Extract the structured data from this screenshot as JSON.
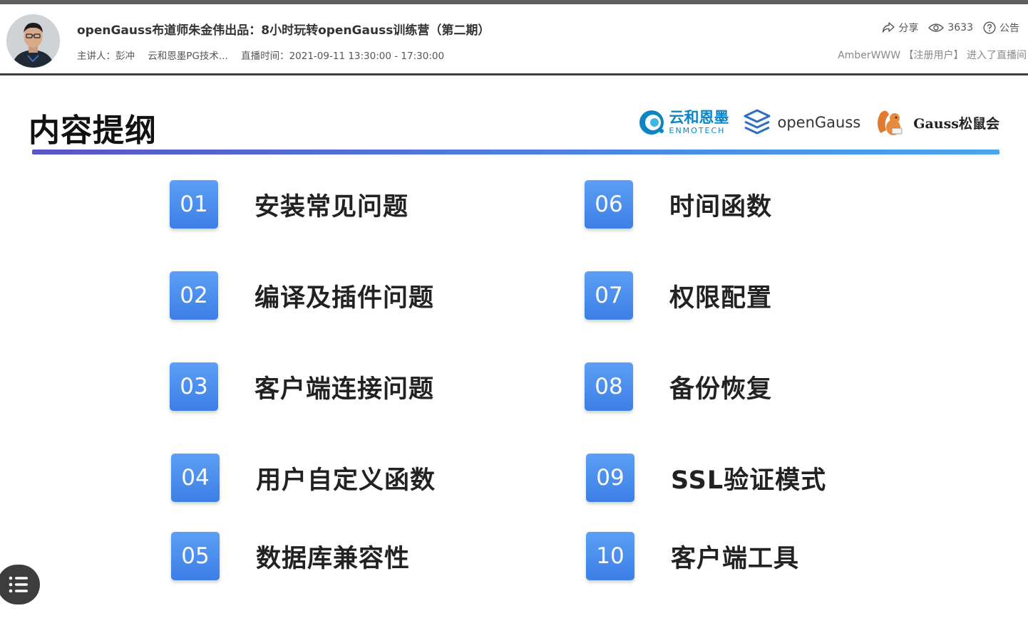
{
  "header": {
    "title": "openGauss布道师朱金伟出品：8小时玩转openGauss训练营（第二期）",
    "presenter": "主讲人：彭冲",
    "organizer": "云和恩墨PG技术...",
    "broadcast_time": "直播时间：2021-09-11 13:30:00 - 17:30:00",
    "share_label": "分享",
    "view_count": "3633",
    "notice_label": "公告",
    "join_notice": "AmberWWW 【注册用户】 进入了直播间"
  },
  "slide": {
    "title": "内容提纲",
    "logos": {
      "enmo_cn": "云和恩墨",
      "enmo_en": "ENMOTECH",
      "opengauss": "openGauss",
      "gauss_club": "Gauss松鼠会"
    },
    "items": [
      {
        "num": "01",
        "label": "安装常见问题"
      },
      {
        "num": "02",
        "label": "编译及插件问题"
      },
      {
        "num": "03",
        "label": "客户端连接问题"
      },
      {
        "num": "04",
        "label": "用户自定义函数"
      },
      {
        "num": "05",
        "label": "数据库兼容性"
      },
      {
        "num": "06",
        "label": "时间函数"
      },
      {
        "num": "07",
        "label": "权限配置"
      },
      {
        "num": "08",
        "label": "备份恢复"
      },
      {
        "num": "09",
        "label": "SSL验证模式"
      },
      {
        "num": "10",
        "label": "客户端工具"
      }
    ]
  },
  "colors": {
    "accent_blue": "#4a8ef0",
    "enmo_blue": "#0b85c3",
    "header_border": "#3c3c3c"
  }
}
